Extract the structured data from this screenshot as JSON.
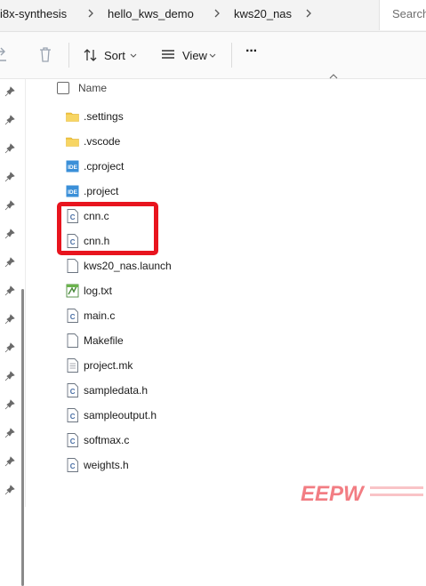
{
  "address": {
    "crumbs": [
      "i8x-synthesis",
      "hello_kws_demo",
      "kws20_nas"
    ],
    "search_placeholder": "Search"
  },
  "toolbar": {
    "sort_label": "Sort",
    "view_label": "View",
    "more_label": "···"
  },
  "list": {
    "name_header": "Name",
    "files": [
      {
        "name": ".settings",
        "icon": "folder-icon"
      },
      {
        "name": ".vscode",
        "icon": "folder-icon"
      },
      {
        "name": ".cproject",
        "icon": "ide-file-icon"
      },
      {
        "name": ".project",
        "icon": "ide-file-icon"
      },
      {
        "name": "cnn.c",
        "icon": "c-source-file-icon"
      },
      {
        "name": "cnn.h",
        "icon": "c-source-file-icon"
      },
      {
        "name": "kws20_nas.launch",
        "icon": "blank-file-icon"
      },
      {
        "name": "log.txt",
        "icon": "text-file-icon"
      },
      {
        "name": "main.c",
        "icon": "c-source-file-icon"
      },
      {
        "name": "Makefile",
        "icon": "blank-file-icon"
      },
      {
        "name": "project.mk",
        "icon": "text-file-icon"
      },
      {
        "name": "sampledata.h",
        "icon": "c-source-file-icon"
      },
      {
        "name": "sampleoutput.h",
        "icon": "c-source-file-icon"
      },
      {
        "name": "softmax.c",
        "icon": "c-source-file-icon"
      },
      {
        "name": "weights.h",
        "icon": "c-source-file-icon"
      }
    ]
  },
  "colors": {
    "highlight": "#e8141e",
    "folder": "#f2c744",
    "ide_badge": "#3a8fd8",
    "watermark": "#e8141e"
  },
  "watermark": {
    "text": "EEPW"
  }
}
